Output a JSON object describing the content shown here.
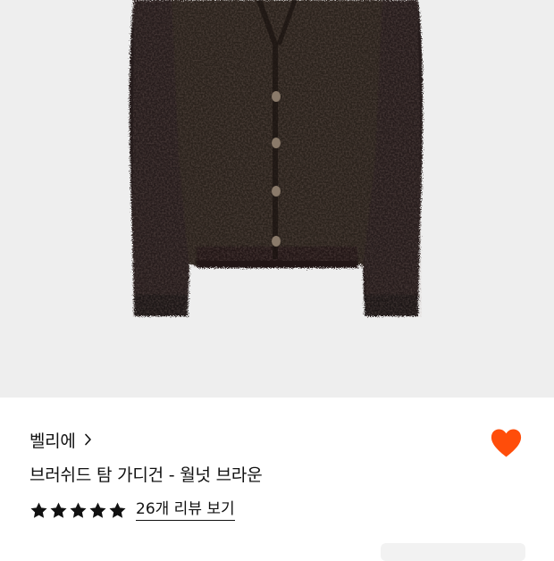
{
  "product": {
    "brand": "벨리에",
    "name": "브러쉬드 탐 가디건 - 월넛 브라운",
    "rating_stars": 5,
    "review_link": "26개 리뷰 보기",
    "wishlisted": true
  },
  "icons": {
    "brand_chevron": "chevron-right-icon",
    "star": "star-icon",
    "wishlist": "heart-icon"
  },
  "colors": {
    "image_background": "#eeeeee",
    "garment": "#2a201d",
    "heart": "#ff4d0a",
    "star": "#111111",
    "text": "#111111"
  }
}
